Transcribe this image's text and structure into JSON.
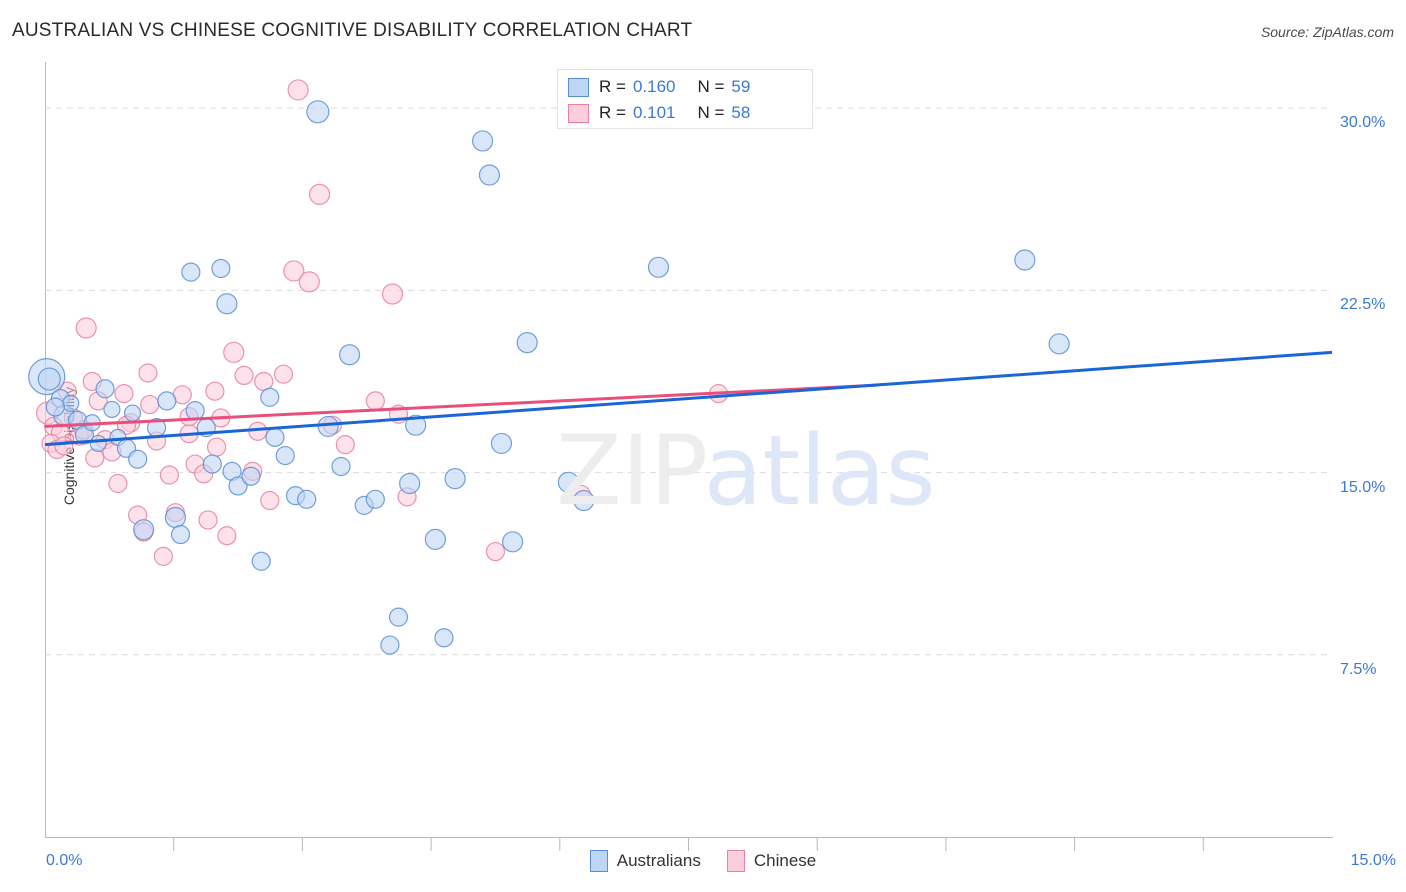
{
  "header": {
    "title": "AUSTRALIAN VS CHINESE COGNITIVE DISABILITY CORRELATION CHART",
    "source": "Source: ZipAtlas.com"
  },
  "watermark": {
    "part1": "ZIP",
    "part2": "atlas"
  },
  "stats_legend": {
    "rows": [
      {
        "series": "Australians",
        "color": "#bed6f4",
        "r_key": "R =",
        "r_value": "0.160",
        "n_key": "N =",
        "n_value": "59"
      },
      {
        "series": "Chinese",
        "color": "#fbcedd",
        "r_key": "R =",
        "r_value": "0.101",
        "n_key": "N =",
        "n_value": "58"
      }
    ]
  },
  "series_legend": [
    {
      "label": "Australians",
      "color": "#bed6f4"
    },
    {
      "label": "Chinese",
      "color": "#fbcedd"
    }
  ],
  "axes": {
    "y_title": "Cognitive Disability",
    "y_ticks": [
      "30.0%",
      "22.5%",
      "15.0%",
      "7.5%"
    ],
    "x_min_label": "0.0%",
    "x_max_label": "15.0%"
  },
  "chart_data": {
    "type": "scatter",
    "title": "AUSTRALIAN VS CHINESE COGNITIVE DISABILITY CORRELATION CHART",
    "xlabel": "",
    "ylabel": "Cognitive Disability",
    "xlim": [
      0.0,
      15.0
    ],
    "ylim": [
      0.0,
      31.9
    ],
    "x_unit": "%",
    "y_unit": "%",
    "grid": true,
    "y_gridlines": [
      30.0,
      22.5,
      15.0,
      7.5
    ],
    "legend_position": "bottom-center",
    "series": [
      {
        "name": "Australians",
        "color": "#bed6f4",
        "edge_color": "#5b8fd4",
        "R": 0.16,
        "N": 59,
        "trendline": {
          "x0": 0.0,
          "y0": 16.15,
          "x1": 15.0,
          "y1": 19.95,
          "color": "#1a66d6"
        },
        "points": [
          {
            "x": 0.02,
            "y": 18.95,
            "r": 18
          },
          {
            "x": 0.05,
            "y": 18.85,
            "r": 11
          },
          {
            "x": 0.18,
            "y": 18.05,
            "r": 9
          },
          {
            "x": 0.22,
            "y": 17.35,
            "r": 10
          },
          {
            "x": 0.3,
            "y": 17.85,
            "r": 8
          },
          {
            "x": 0.38,
            "y": 17.15,
            "r": 9
          },
          {
            "x": 0.46,
            "y": 16.55,
            "r": 9
          },
          {
            "x": 0.55,
            "y": 17.05,
            "r": 8
          },
          {
            "x": 0.62,
            "y": 16.2,
            "r": 8
          },
          {
            "x": 0.7,
            "y": 18.45,
            "r": 9
          },
          {
            "x": 0.78,
            "y": 17.6,
            "r": 8
          },
          {
            "x": 0.85,
            "y": 16.45,
            "r": 8
          },
          {
            "x": 0.95,
            "y": 16.0,
            "r": 9
          },
          {
            "x": 1.02,
            "y": 17.45,
            "r": 8
          },
          {
            "x": 1.08,
            "y": 15.55,
            "r": 9
          },
          {
            "x": 1.15,
            "y": 12.65,
            "r": 10
          },
          {
            "x": 1.3,
            "y": 16.85,
            "r": 9
          },
          {
            "x": 1.42,
            "y": 17.95,
            "r": 9
          },
          {
            "x": 1.52,
            "y": 13.15,
            "r": 10
          },
          {
            "x": 1.58,
            "y": 12.45,
            "r": 9
          },
          {
            "x": 1.7,
            "y": 23.25,
            "r": 9
          },
          {
            "x": 1.75,
            "y": 17.55,
            "r": 9
          },
          {
            "x": 1.88,
            "y": 16.85,
            "r": 9
          },
          {
            "x": 1.95,
            "y": 15.35,
            "r": 9
          },
          {
            "x": 2.05,
            "y": 23.4,
            "r": 9
          },
          {
            "x": 2.12,
            "y": 21.95,
            "r": 10
          },
          {
            "x": 2.18,
            "y": 15.05,
            "r": 9
          },
          {
            "x": 2.25,
            "y": 14.45,
            "r": 9
          },
          {
            "x": 2.4,
            "y": 14.85,
            "r": 9
          },
          {
            "x": 2.52,
            "y": 11.35,
            "r": 9
          },
          {
            "x": 2.62,
            "y": 18.1,
            "r": 9
          },
          {
            "x": 2.68,
            "y": 16.45,
            "r": 9
          },
          {
            "x": 2.8,
            "y": 15.7,
            "r": 9
          },
          {
            "x": 2.92,
            "y": 14.05,
            "r": 9
          },
          {
            "x": 3.05,
            "y": 13.9,
            "r": 9
          },
          {
            "x": 3.18,
            "y": 29.85,
            "r": 11
          },
          {
            "x": 3.3,
            "y": 16.9,
            "r": 10
          },
          {
            "x": 3.45,
            "y": 15.25,
            "r": 9
          },
          {
            "x": 3.55,
            "y": 19.85,
            "r": 10
          },
          {
            "x": 3.72,
            "y": 13.65,
            "r": 9
          },
          {
            "x": 3.85,
            "y": 13.9,
            "r": 9
          },
          {
            "x": 4.02,
            "y": 7.9,
            "r": 9
          },
          {
            "x": 4.12,
            "y": 9.05,
            "r": 9
          },
          {
            "x": 4.25,
            "y": 14.55,
            "r": 10
          },
          {
            "x": 4.32,
            "y": 16.95,
            "r": 10
          },
          {
            "x": 4.55,
            "y": 12.25,
            "r": 10
          },
          {
            "x": 4.65,
            "y": 8.2,
            "r": 9
          },
          {
            "x": 4.78,
            "y": 14.75,
            "r": 10
          },
          {
            "x": 5.1,
            "y": 28.65,
            "r": 10
          },
          {
            "x": 5.18,
            "y": 27.25,
            "r": 10
          },
          {
            "x": 5.32,
            "y": 16.2,
            "r": 10
          },
          {
            "x": 5.45,
            "y": 12.15,
            "r": 10
          },
          {
            "x": 5.62,
            "y": 20.35,
            "r": 10
          },
          {
            "x": 6.1,
            "y": 14.6,
            "r": 10
          },
          {
            "x": 6.28,
            "y": 13.85,
            "r": 10
          },
          {
            "x": 7.15,
            "y": 23.45,
            "r": 10
          },
          {
            "x": 11.42,
            "y": 23.75,
            "r": 10
          },
          {
            "x": 11.82,
            "y": 20.3,
            "r": 10
          },
          {
            "x": 0.12,
            "y": 17.7,
            "r": 9
          }
        ]
      },
      {
        "name": "Chinese",
        "color": "#fbcedd",
        "edge_color": "#e8809f",
        "R": 0.101,
        "N": 58,
        "trendline": {
          "x0": 0.0,
          "y0": 16.9,
          "x1": 9.7,
          "y1": 18.6,
          "color": "#e84f7a"
        },
        "points": [
          {
            "x": 0.03,
            "y": 17.45,
            "r": 11
          },
          {
            "x": 0.1,
            "y": 16.9,
            "r": 9
          },
          {
            "x": 0.18,
            "y": 16.65,
            "r": 9
          },
          {
            "x": 0.26,
            "y": 18.35,
            "r": 9
          },
          {
            "x": 0.33,
            "y": 17.25,
            "r": 9
          },
          {
            "x": 0.4,
            "y": 16.5,
            "r": 9
          },
          {
            "x": 0.48,
            "y": 20.95,
            "r": 10
          },
          {
            "x": 0.55,
            "y": 18.75,
            "r": 9
          },
          {
            "x": 0.62,
            "y": 17.95,
            "r": 9
          },
          {
            "x": 0.7,
            "y": 16.35,
            "r": 9
          },
          {
            "x": 0.78,
            "y": 15.85,
            "r": 9
          },
          {
            "x": 0.85,
            "y": 14.55,
            "r": 9
          },
          {
            "x": 0.92,
            "y": 18.25,
            "r": 9
          },
          {
            "x": 1.0,
            "y": 17.05,
            "r": 9
          },
          {
            "x": 1.08,
            "y": 13.25,
            "r": 9
          },
          {
            "x": 1.15,
            "y": 12.55,
            "r": 9
          },
          {
            "x": 1.22,
            "y": 17.8,
            "r": 9
          },
          {
            "x": 1.3,
            "y": 16.3,
            "r": 9
          },
          {
            "x": 1.38,
            "y": 11.55,
            "r": 9
          },
          {
            "x": 1.45,
            "y": 14.9,
            "r": 9
          },
          {
            "x": 1.52,
            "y": 13.35,
            "r": 9
          },
          {
            "x": 1.6,
            "y": 18.2,
            "r": 9
          },
          {
            "x": 1.68,
            "y": 16.6,
            "r": 9
          },
          {
            "x": 1.75,
            "y": 15.35,
            "r": 9
          },
          {
            "x": 1.85,
            "y": 14.95,
            "r": 9
          },
          {
            "x": 1.9,
            "y": 13.05,
            "r": 9
          },
          {
            "x": 1.98,
            "y": 18.35,
            "r": 9
          },
          {
            "x": 2.05,
            "y": 17.25,
            "r": 9
          },
          {
            "x": 2.12,
            "y": 12.4,
            "r": 9
          },
          {
            "x": 2.2,
            "y": 19.95,
            "r": 10
          },
          {
            "x": 2.32,
            "y": 19.0,
            "r": 9
          },
          {
            "x": 2.42,
            "y": 15.05,
            "r": 9
          },
          {
            "x": 2.55,
            "y": 18.75,
            "r": 9
          },
          {
            "x": 2.62,
            "y": 13.85,
            "r": 9
          },
          {
            "x": 2.78,
            "y": 19.05,
            "r": 9
          },
          {
            "x": 2.9,
            "y": 23.3,
            "r": 10
          },
          {
            "x": 2.95,
            "y": 30.75,
            "r": 10
          },
          {
            "x": 3.08,
            "y": 22.85,
            "r": 10
          },
          {
            "x": 3.2,
            "y": 26.45,
            "r": 10
          },
          {
            "x": 3.35,
            "y": 16.95,
            "r": 9
          },
          {
            "x": 3.5,
            "y": 16.15,
            "r": 9
          },
          {
            "x": 3.85,
            "y": 17.95,
            "r": 9
          },
          {
            "x": 4.05,
            "y": 22.35,
            "r": 10
          },
          {
            "x": 4.12,
            "y": 17.4,
            "r": 9
          },
          {
            "x": 4.22,
            "y": 14.0,
            "r": 9
          },
          {
            "x": 5.25,
            "y": 11.75,
            "r": 9
          },
          {
            "x": 6.25,
            "y": 14.1,
            "r": 9
          },
          {
            "x": 7.85,
            "y": 18.25,
            "r": 9
          },
          {
            "x": 0.07,
            "y": 16.2,
            "r": 9
          },
          {
            "x": 0.14,
            "y": 15.95,
            "r": 9
          },
          {
            "x": 0.22,
            "y": 16.1,
            "r": 9
          },
          {
            "x": 0.45,
            "y": 16.75,
            "r": 9
          },
          {
            "x": 0.58,
            "y": 15.6,
            "r": 9
          },
          {
            "x": 0.95,
            "y": 16.95,
            "r": 9
          },
          {
            "x": 1.68,
            "y": 17.3,
            "r": 9
          },
          {
            "x": 2.0,
            "y": 16.05,
            "r": 9
          },
          {
            "x": 2.48,
            "y": 16.7,
            "r": 9
          },
          {
            "x": 1.2,
            "y": 19.1,
            "r": 9
          }
        ]
      }
    ]
  }
}
